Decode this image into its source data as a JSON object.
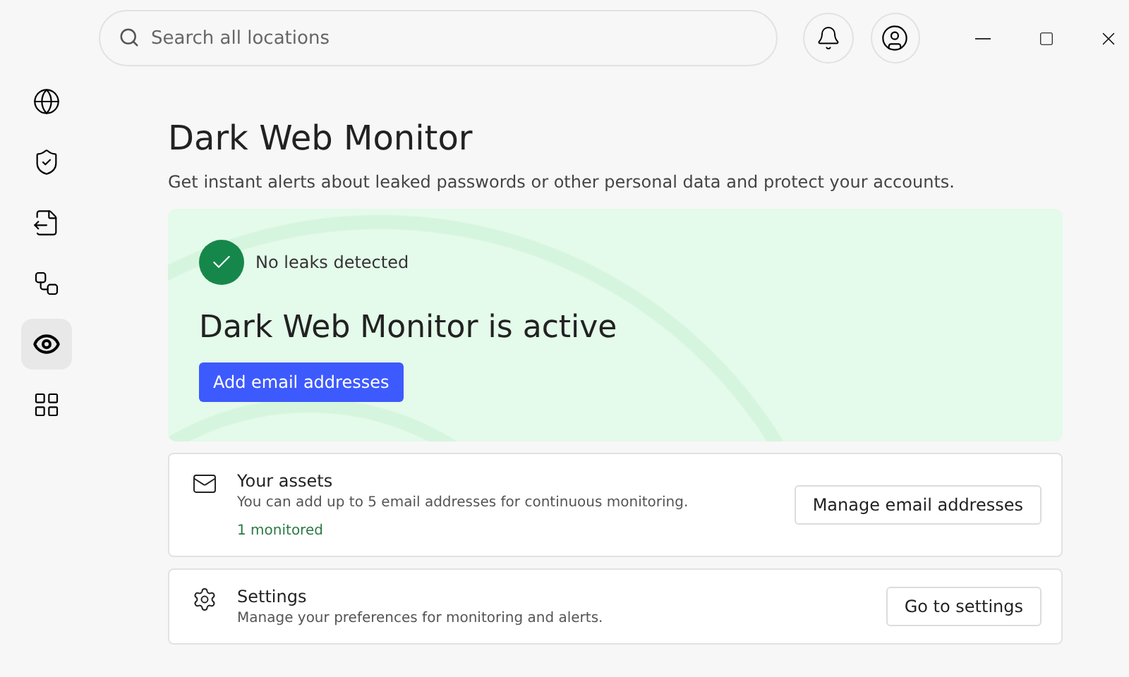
{
  "search": {
    "placeholder": "Search all locations"
  },
  "sidebar": {
    "items": [
      {
        "selected": false
      },
      {
        "selected": false
      },
      {
        "selected": false
      },
      {
        "selected": false
      },
      {
        "selected": true
      },
      {
        "selected": false
      }
    ]
  },
  "page": {
    "title": "Dark Web Monitor",
    "subtitle": "Get instant alerts about leaked passwords or other personal data and protect your accounts."
  },
  "status_card": {
    "status": "No leaks detected",
    "heading": "Dark Web Monitor is active",
    "button": "Add email addresses"
  },
  "cards": [
    {
      "kind": "email",
      "title": "Your assets",
      "description": "You can add up to 5 email addresses for continuous monitoring.",
      "note": "1 monitored",
      "button": "Manage email addresses"
    },
    {
      "kind": "settings",
      "title": "Settings",
      "description": "Manage your preferences for monitoring and alerts.",
      "button": "Go to settings"
    }
  ]
}
